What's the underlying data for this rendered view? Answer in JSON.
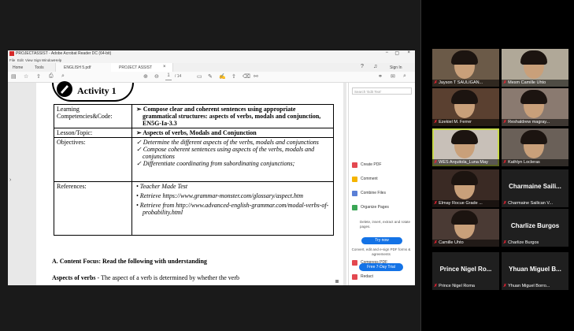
{
  "acrobat": {
    "title": "PROJECTASSIST - Adobe Acrobat Reader DC (64-bit)",
    "menu": [
      "File",
      "Edit",
      "View",
      "Sign",
      "Window",
      "Help"
    ],
    "tabs": [
      "Home",
      "Tools",
      "ENGLISH 5.pdf",
      "PROJECT ASSIST"
    ],
    "sign_in": "Sign In",
    "page_current": "1",
    "page_total": "/ 14",
    "window_controls": [
      "−",
      "▢",
      "×"
    ]
  },
  "document": {
    "activity_title": "Activity 1",
    "table": [
      {
        "label": "Learning Competencies&Code:",
        "items": [
          "Compose clear and coherent sentences using appropriate grammatical structures: aspects of verbs, modals and conjunction, EN5G-Ia-3.3"
        ]
      },
      {
        "label": "Lesson/Topic:",
        "items": [
          "Aspects of verbs, Modals and Conjunction"
        ]
      },
      {
        "label": "Objectives:",
        "items": [
          "Determine the different aspects of the verbs, modals and conjunctions",
          "Compose coherent sentences using aspects of the verbs, modals and conjunctions",
          "Differentiate coordinating from subordinating conjunctions;"
        ]
      },
      {
        "label": "References:",
        "items": [
          "Teacher Made Test",
          "Retrieve https://www.grammar-monster.com/glossary/aspect.htm",
          "Retrieve from http://www.advanced-english-grammar.com/modal-verbs-of-probability.html"
        ]
      }
    ],
    "section_heading": "A. Content Focus: Read the following with understanding",
    "para_bold": "Aspects of verbs",
    "para_text": " - The aspect of a verb is determined by whether the verb"
  },
  "right_pane": {
    "search_placeholder": "Search 'Edit Text'",
    "tools": [
      {
        "label": "Create PDF",
        "color": "#e34850",
        "icon": "create-pdf-icon"
      },
      {
        "label": "Comment",
        "color": "#f5b400",
        "icon": "comment-icon"
      },
      {
        "label": "Combine Files",
        "color": "#5a7fd6",
        "icon": "combine-files-icon"
      },
      {
        "label": "Organize Pages",
        "color": "#3aa655",
        "icon": "organize-pages-icon"
      }
    ],
    "promo_text": "Delete, insert, extract and rotate pages.",
    "try_now": "Try now",
    "tools2": [
      {
        "label": "Compress PDF",
        "color": "#e34850",
        "icon": "compress-pdf-icon"
      },
      {
        "label": "Redact",
        "color": "#e34850",
        "icon": "redact-icon"
      }
    ],
    "convert_text": "Convert, edit and e-sign PDF forms & agreements",
    "free_trial": "Free 7-Day Trial"
  },
  "participants": [
    {
      "name": "Jayson T SAULIGAN...",
      "type": "video",
      "bg": "#6b5a48"
    },
    {
      "name": "Mesm Camille Uhto",
      "type": "video",
      "bg": "#b0a898"
    },
    {
      "name": "Ezekiel M. Ferrer",
      "type": "video",
      "bg": "#5a4030"
    },
    {
      "name": "Reshaldrew magray...",
      "type": "video",
      "bg": "#8a7a70"
    },
    {
      "name": "WES Arquitola_Luna May",
      "type": "video",
      "bg": "#c8c0b8",
      "speaking": true
    },
    {
      "name": "Kathlyn Locleras",
      "type": "video",
      "bg": "#6a6058"
    },
    {
      "name": "Elmay Rocue Grade ...",
      "type": "video",
      "bg": "#3a2a24"
    },
    {
      "name": "Charmaine Sailican V...",
      "type": "blank",
      "big": "Charmaine Saili..."
    },
    {
      "name": "Camille Uhto",
      "type": "video",
      "bg": "#4a3a34"
    },
    {
      "name": "Charlize Burgos",
      "type": "blank",
      "big": "Charlize Burgos"
    },
    {
      "name": "Prince Nigel Roma",
      "type": "blank",
      "big": "Prince Nigel Ro..."
    },
    {
      "name": "Yhuan Miguel Borro...",
      "type": "blank",
      "big": "Yhuan Miguel B..."
    }
  ]
}
